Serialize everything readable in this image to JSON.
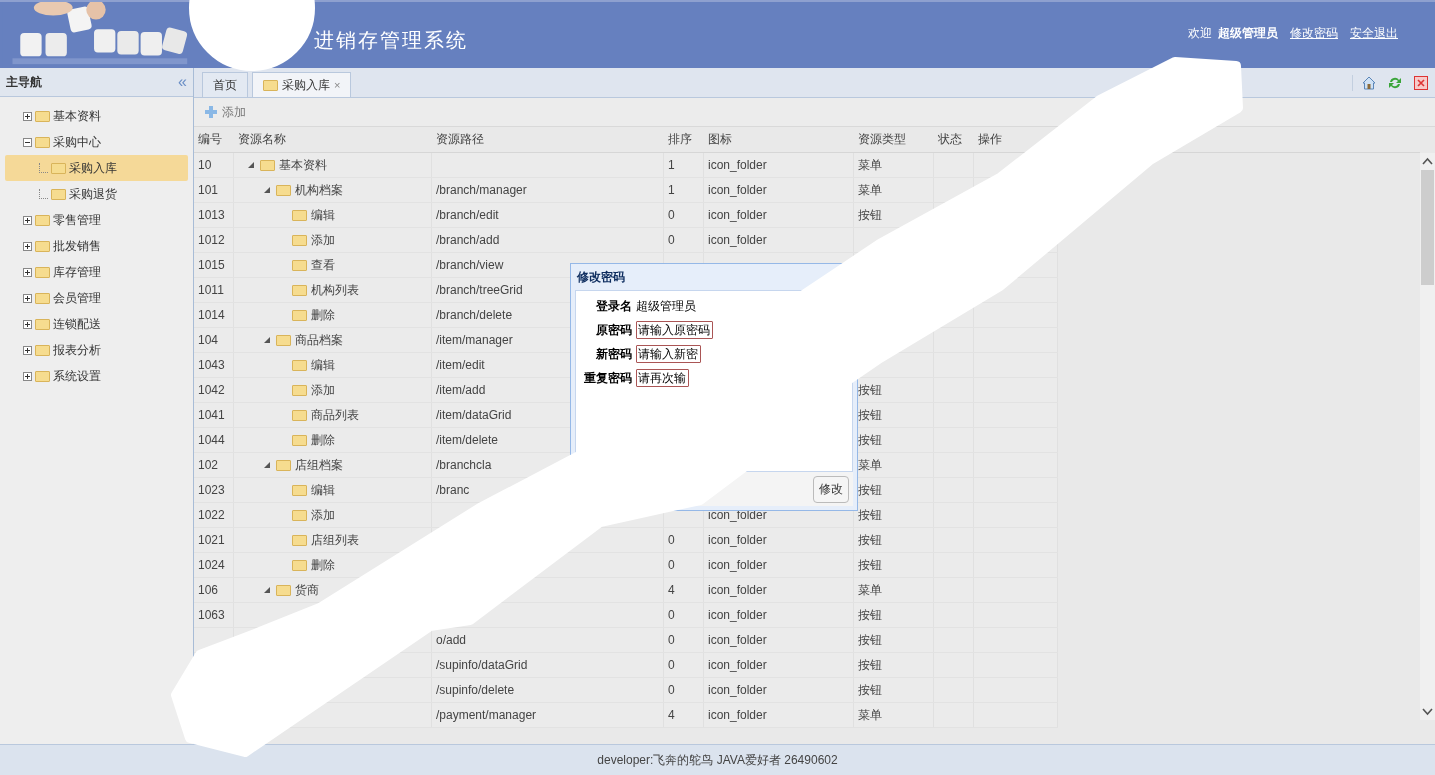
{
  "header": {
    "title": "进销存管理系统",
    "welcome": "欢迎",
    "user": "超级管理员",
    "links": [
      "修改密码",
      "安全退出"
    ]
  },
  "sidebar": {
    "title": "主导航",
    "collapse_icon": "«",
    "items": [
      {
        "label": "基本资料",
        "expanded": false,
        "selected": false
      },
      {
        "label": "采购中心",
        "expanded": true,
        "selected": false,
        "children": [
          {
            "label": "采购入库",
            "selected": true
          },
          {
            "label": "采购退货",
            "selected": false
          }
        ]
      },
      {
        "label": "零售管理",
        "expanded": false,
        "selected": false
      },
      {
        "label": "批发销售",
        "expanded": false,
        "selected": false
      },
      {
        "label": "库存管理",
        "expanded": false,
        "selected": false
      },
      {
        "label": "会员管理",
        "expanded": false,
        "selected": false
      },
      {
        "label": "连锁配送",
        "expanded": false,
        "selected": false
      },
      {
        "label": "报表分析",
        "expanded": false,
        "selected": false
      },
      {
        "label": "系统设置",
        "expanded": false,
        "selected": false
      }
    ]
  },
  "tabs": [
    {
      "label": "首页",
      "selected": false,
      "closable": false
    },
    {
      "label": "采购入库",
      "selected": true,
      "closable": true,
      "close": "×"
    }
  ],
  "toolbar": {
    "add": "添加"
  },
  "table": {
    "columns": [
      "编号",
      "资源名称",
      "资源路径",
      "排序",
      "图标",
      "资源类型",
      "状态",
      "操作"
    ],
    "rows": [
      {
        "id": "10",
        "name": "基本资料",
        "sort": "1",
        "icon": "icon_folder",
        "type": "菜单",
        "expanded": true,
        "children": [
          {
            "id": "101",
            "name": "机构档案",
            "path": "/branch/manager",
            "sort": "1",
            "icon": "icon_folder",
            "type": "菜单",
            "expanded": true,
            "children": [
              {
                "id": "1013",
                "name": "编辑",
                "path": "/branch/edit",
                "sort": "0",
                "icon": "icon_folder",
                "type": "按钮"
              },
              {
                "id": "1012",
                "name": "添加",
                "path": "/branch/add",
                "sort": "0",
                "icon": "icon_folder"
              },
              {
                "id": "1015",
                "name": "查看",
                "path": "/branch/view"
              },
              {
                "id": "1011",
                "name": "机构列表",
                "path": "/branch/treeGrid"
              },
              {
                "id": "1014",
                "name": "删除",
                "path": "/branch/delete"
              }
            ]
          },
          {
            "id": "104",
            "name": "商品档案",
            "path": "/item/manager",
            "expanded": true,
            "children": [
              {
                "id": "1043",
                "name": "编辑",
                "path": "/item/edit"
              },
              {
                "id": "1042",
                "name": "添加",
                "path": "/item/add",
                "type": "按钮"
              },
              {
                "id": "1041",
                "name": "商品列表",
                "path": "/item/dataGrid",
                "type": "按钮"
              },
              {
                "id": "1044",
                "name": "删除",
                "path": "/item/delete",
                "type": "按钮"
              }
            ]
          },
          {
            "id": "102",
            "name": "店组档案",
            "path": "/branchcla",
            "type": "菜单",
            "expanded": true,
            "children": [
              {
                "id": "1023",
                "name": "编辑",
                "path": "/branc",
                "type": "按钮"
              },
              {
                "id": "1022",
                "name": "添加",
                "icon": "icon_folder",
                "type": "按钮"
              },
              {
                "id": "1021",
                "name": "店组列表",
                "sort": "0",
                "icon": "icon_folder",
                "type": "按钮"
              },
              {
                "id": "1024",
                "name": "删除",
                "sort": "0",
                "icon": "icon_folder",
                "type": "按钮"
              }
            ]
          },
          {
            "id": "106",
            "name": "货商",
            "sort": "4",
            "icon": "icon_folder",
            "type": "菜单",
            "expanded": true,
            "children": [
              {
                "id": "1063",
                "sort": "0",
                "icon": "icon_folder",
                "type": "按钮"
              },
              {
                "path": "o/add",
                "sort": "0",
                "icon": "icon_folder",
                "type": "按钮"
              },
              {
                "path": "/supinfo/dataGrid",
                "sort": "0",
                "icon": "icon_folder",
                "type": "按钮"
              },
              {
                "path": "/supinfo/delete",
                "sort": "0",
                "icon": "icon_folder",
                "type": "按钮"
              }
            ]
          },
          {
            "path": "/payment/manager",
            "sort": "4",
            "icon": "icon_folder",
            "type": "菜单"
          }
        ]
      }
    ]
  },
  "dialog": {
    "title": "修改密码",
    "fields": [
      {
        "kind": "text",
        "label": "登录名",
        "value": "超级管理员"
      },
      {
        "kind": "input",
        "label": "原密码",
        "placeholder": "请输入原密码"
      },
      {
        "kind": "input",
        "label": "新密码",
        "placeholder": "请输入新密"
      },
      {
        "kind": "input",
        "label": "重复密码",
        "placeholder": "请再次输"
      }
    ],
    "button": "修改"
  },
  "footer": "developer:飞奔的鸵鸟 JAVA爱好者 26490602"
}
